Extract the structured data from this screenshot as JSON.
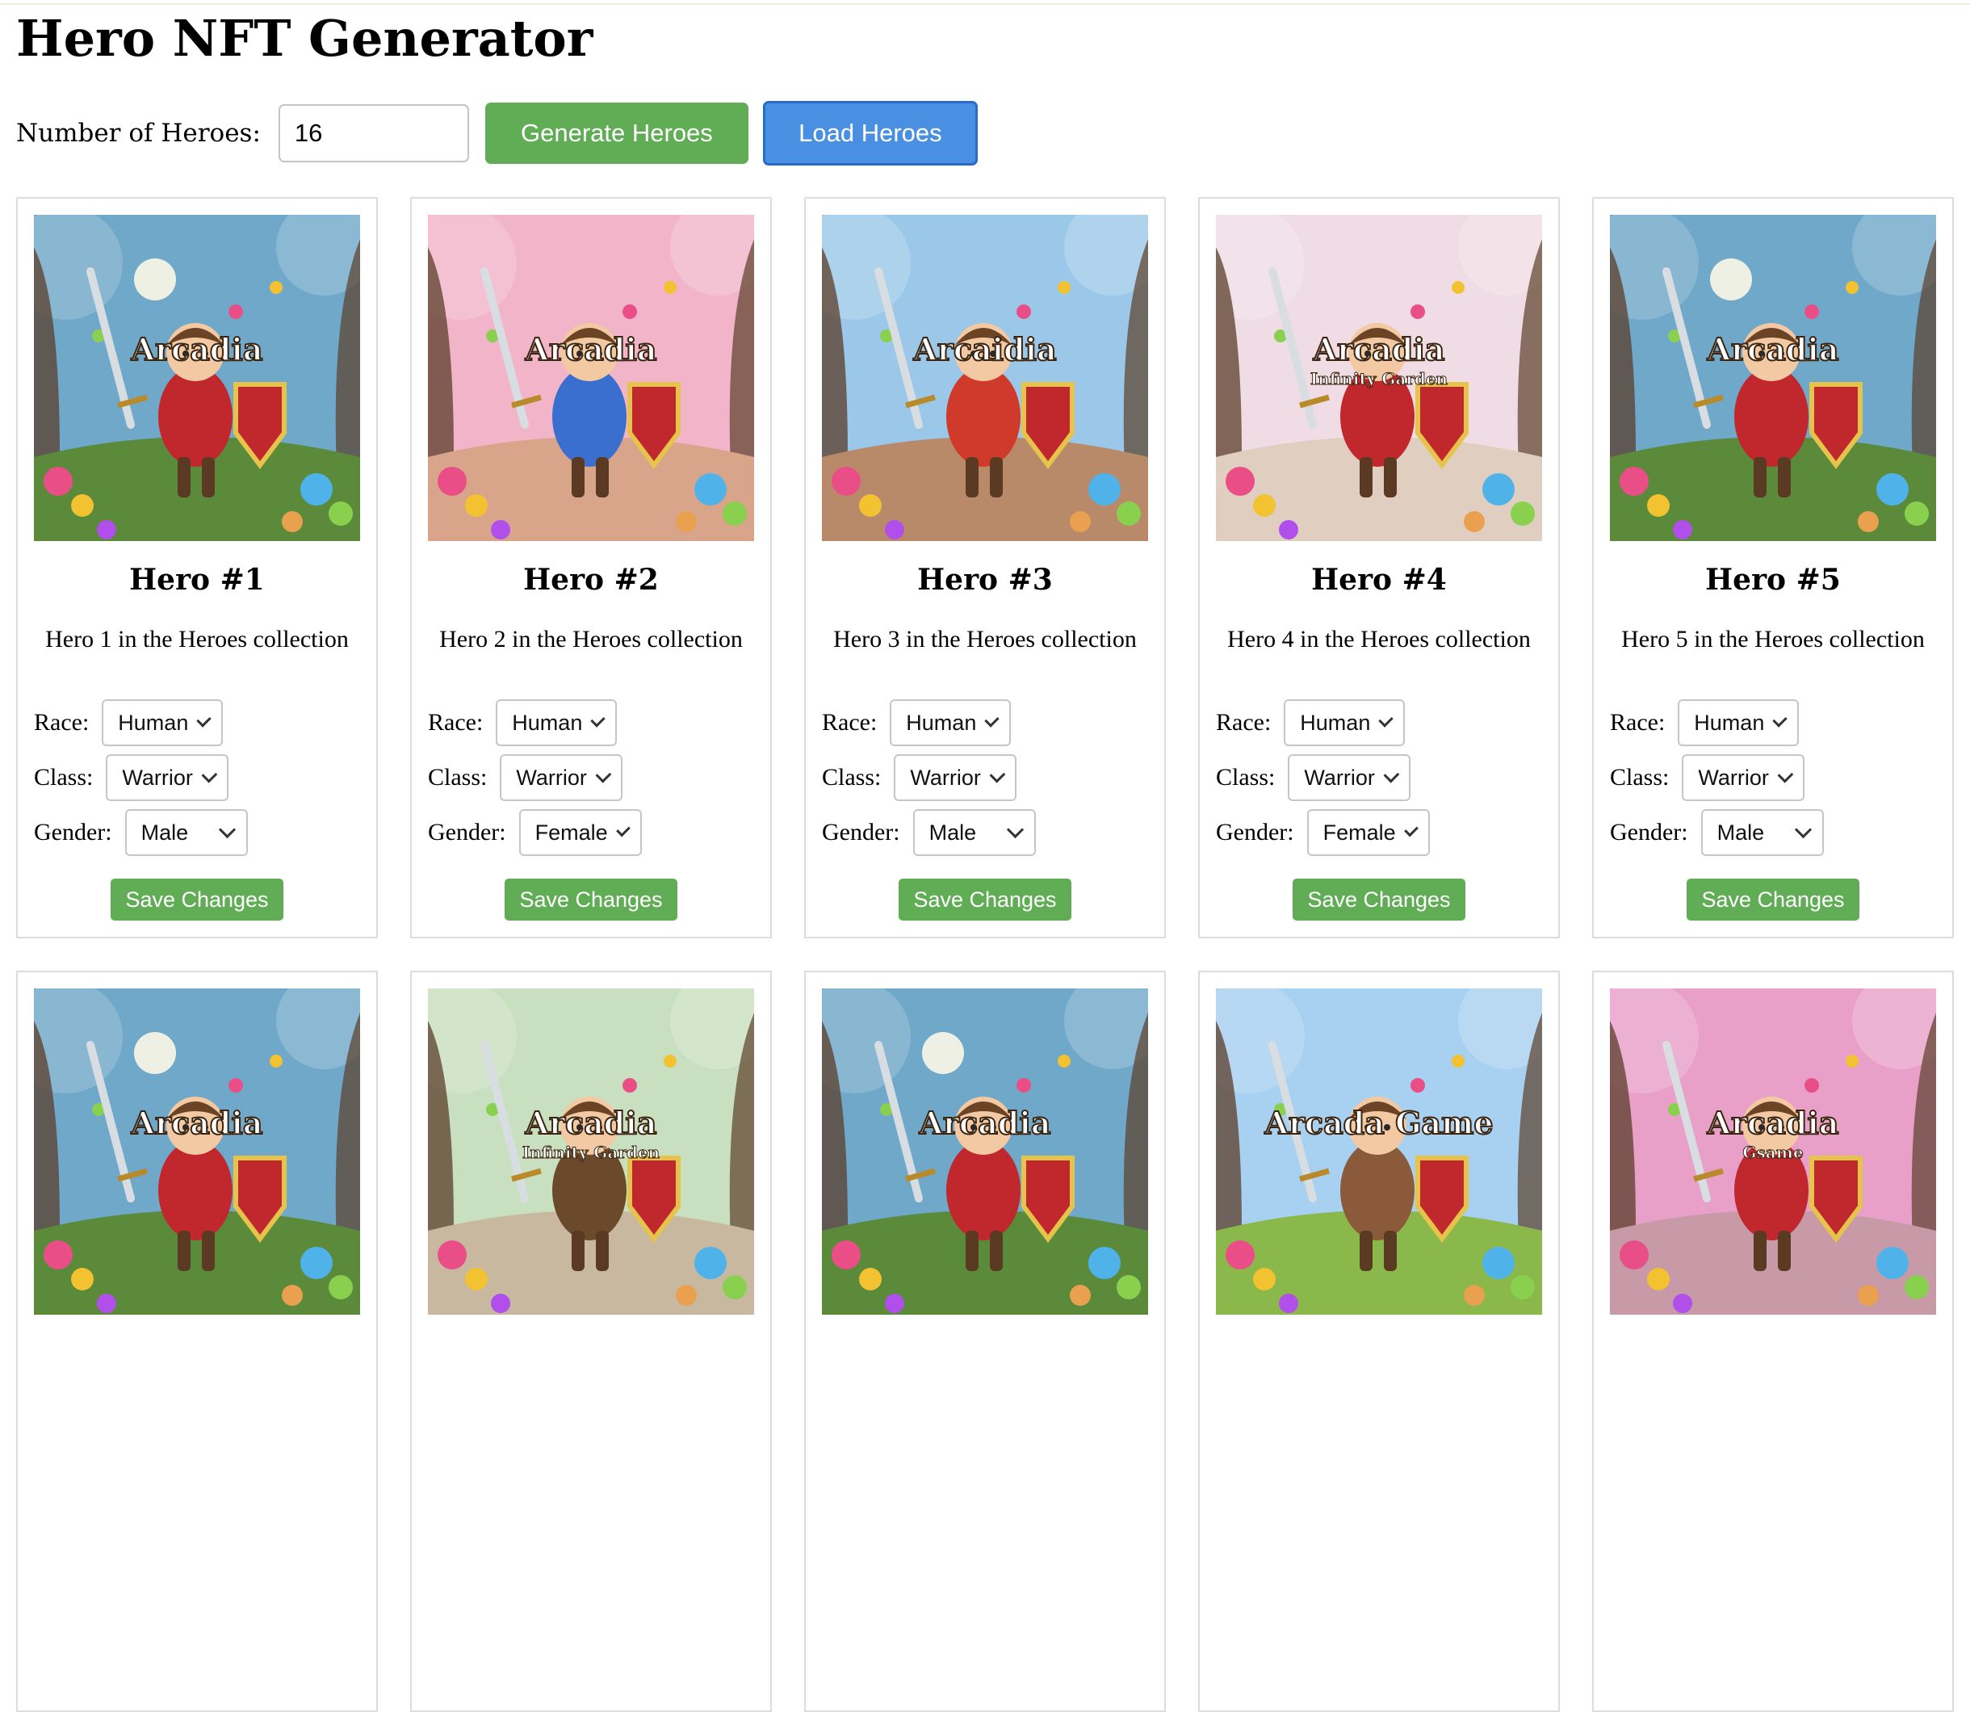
{
  "page": {
    "title": "Hero NFT Generator"
  },
  "controls": {
    "count_label": "Number of Heroes:",
    "count_value": "16",
    "generate_label": "Generate Heroes",
    "load_label": "Load Heroes"
  },
  "labels": {
    "race": "Race:",
    "class": "Class:",
    "gender": "Gender:",
    "save": "Save Changes"
  },
  "heroes": [
    {
      "name": "Hero #1",
      "description": "Hero 1 in the Heroes collection",
      "race": "Human",
      "class": "Warrior",
      "gender": "Male",
      "art": {
        "title": "Arcadia",
        "subtitle": "",
        "bg": "#6fa8c9",
        "ground": "#5a8a3a",
        "accent": "#c0282d",
        "moon": true
      }
    },
    {
      "name": "Hero #2",
      "description": "Hero 2 in the Heroes collection",
      "race": "Human",
      "class": "Warrior",
      "gender": "Female",
      "art": {
        "title": "Arcadia",
        "subtitle": "",
        "bg": "#f2b4c8",
        "ground": "#d9a58a",
        "accent": "#3a6fd0",
        "moon": false
      }
    },
    {
      "name": "Hero #3",
      "description": "Hero 3 in the Heroes collection",
      "race": "Human",
      "class": "Warrior",
      "gender": "Male",
      "art": {
        "title": "Arcaidia",
        "subtitle": "",
        "bg": "#9bc8e8",
        "ground": "#b88a6a",
        "accent": "#d03a2a",
        "moon": false
      }
    },
    {
      "name": "Hero #4",
      "description": "Hero 4 in the Heroes collection",
      "race": "Human",
      "class": "Warrior",
      "gender": "Female",
      "art": {
        "title": "Arcadia",
        "subtitle": "Infinity Garden",
        "bg": "#f0dce4",
        "ground": "#e0cfc0",
        "accent": "#c0282d",
        "moon": false
      }
    },
    {
      "name": "Hero #5",
      "description": "Hero 5 in the Heroes collection",
      "race": "Human",
      "class": "Warrior",
      "gender": "Male",
      "art": {
        "title": "Arcadia",
        "subtitle": "",
        "bg": "#6fa8c9",
        "ground": "#5a8a3a",
        "accent": "#c0282d",
        "moon": true
      }
    },
    {
      "name": "",
      "description": "",
      "race": "",
      "class": "",
      "gender": "",
      "art": {
        "title": "Arcadia",
        "subtitle": "",
        "bg": "#6fa8c9",
        "ground": "#5a8a3a",
        "accent": "#c0282d",
        "moon": true
      }
    },
    {
      "name": "",
      "description": "",
      "race": "",
      "class": "",
      "gender": "",
      "art": {
        "title": "Arcadia",
        "subtitle": "Infinity Garden",
        "bg": "#c8e0c0",
        "ground": "#c8b8a0",
        "accent": "#6a4a2a",
        "moon": false
      }
    },
    {
      "name": "",
      "description": "",
      "race": "",
      "class": "",
      "gender": "",
      "art": {
        "title": "Arcadia",
        "subtitle": "",
        "bg": "#6fa8c9",
        "ground": "#5a8a3a",
        "accent": "#c0282d",
        "moon": true
      }
    },
    {
      "name": "",
      "description": "",
      "race": "",
      "class": "",
      "gender": "",
      "art": {
        "title": "Arcada Game",
        "subtitle": "",
        "bg": "#a8d0f0",
        "ground": "#8ab84a",
        "accent": "#8a5a3a",
        "moon": false
      }
    },
    {
      "name": "",
      "description": "",
      "race": "",
      "class": "",
      "gender": "",
      "art": {
        "title": "Arcadia",
        "subtitle": "Gsame",
        "bg": "#e8a0c8",
        "ground": "#c89aa8",
        "accent": "#c0282d",
        "moon": false
      }
    }
  ]
}
